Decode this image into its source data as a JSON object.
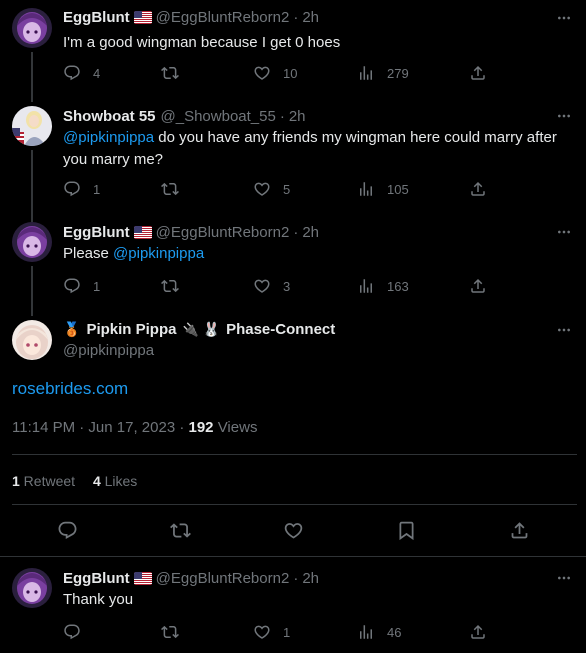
{
  "tweets": [
    {
      "name": "EggBlunt",
      "handle": "@EggBluntReborn2",
      "time": "2h",
      "text": "I'm a good wingman because I get 0 hoes",
      "replies": "4",
      "retweets": "",
      "likes": "10",
      "views": "279"
    },
    {
      "name": "Showboat 55",
      "handle": "@_Showboat_55",
      "time": "2h",
      "mention": "@pipkinpippa",
      "text": " do you have any friends my wingman here could marry after you marry me?",
      "replies": "1",
      "retweets": "",
      "likes": "5",
      "views": "105"
    },
    {
      "name": "EggBlunt",
      "handle": "@EggBluntReborn2",
      "time": "2h",
      "text_prefix": "Please ",
      "mention": "@pipkinpippa",
      "replies": "1",
      "retweets": "",
      "likes": "3",
      "views": "163"
    }
  ],
  "main": {
    "name": "Pipkin Pippa",
    "name_suffix": "Phase-Connect",
    "emoji_prefix": "🥉",
    "handle": "@pipkinpippa",
    "link": "rosebrides.com",
    "timestamp": "11:14 PM · Jun 17, 2023 · ",
    "views_count": "192",
    "views_label": " Views",
    "retweets_count": "1",
    "retweets_label": " Retweet",
    "likes_count": "4",
    "likes_label": " Likes"
  },
  "reply": {
    "name": "EggBlunt",
    "handle": "@EggBluntReborn2",
    "time": "2h",
    "text": "Thank you",
    "replies": "",
    "retweets": "",
    "likes": "1",
    "views": "46"
  },
  "separator": "·",
  "colors": {
    "background": "#000000",
    "text": "#e7e9ea",
    "muted": "#71767b",
    "link": "#1d9bf0",
    "border": "#2f3336"
  }
}
